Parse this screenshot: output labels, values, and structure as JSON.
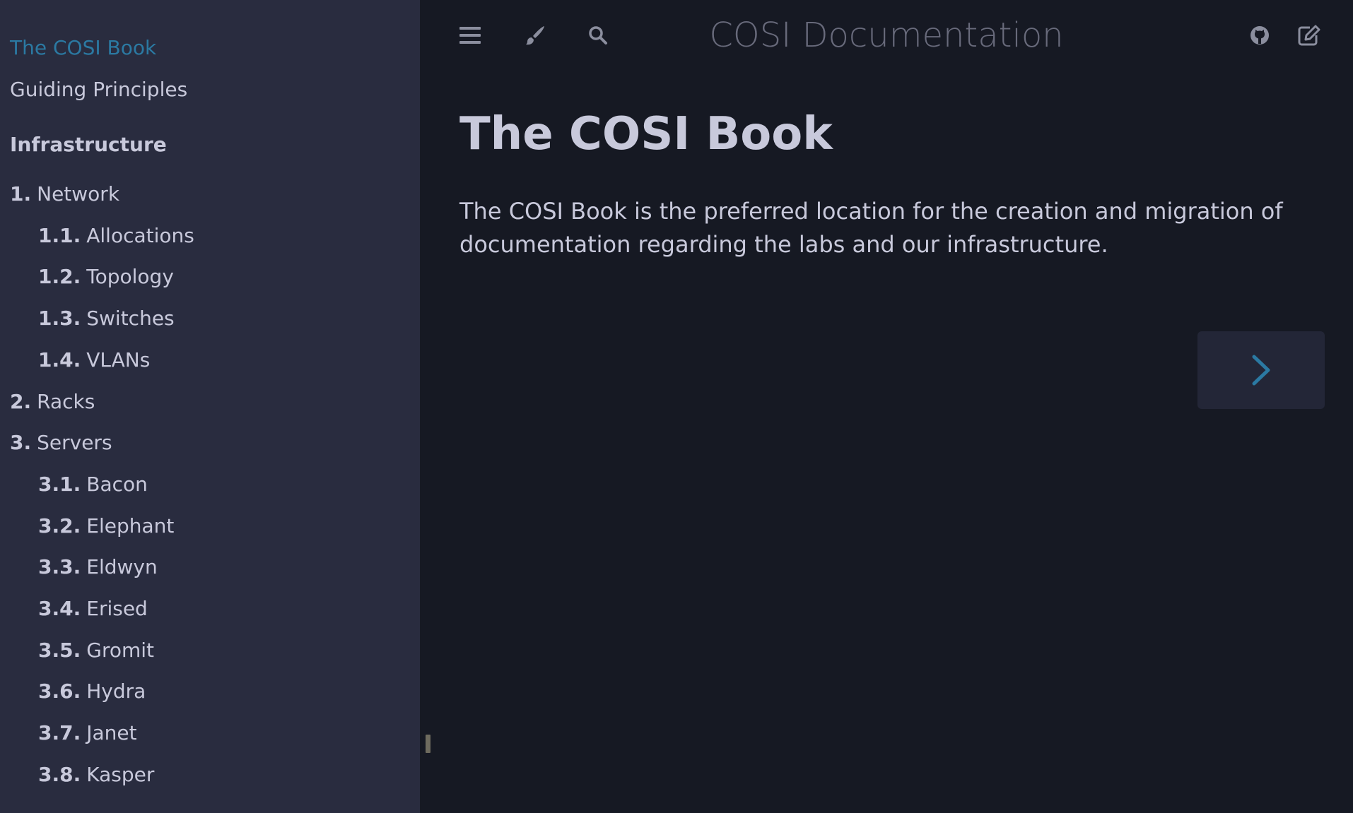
{
  "header": {
    "book_title": "COSI Documentation",
    "icons": [
      "hamburger-icon",
      "paintbrush-icon",
      "search-icon",
      "github-icon",
      "edit-icon"
    ]
  },
  "sidebar": {
    "items": [
      {
        "number": "",
        "label": "The COSI Book",
        "active": true
      },
      {
        "number": "",
        "label": "Guiding Principles"
      },
      {
        "number": "1.",
        "label": "Network"
      },
      {
        "number": "1.1.",
        "label": "Allocations"
      },
      {
        "number": "1.2.",
        "label": "Topology"
      },
      {
        "number": "1.3.",
        "label": "Switches"
      },
      {
        "number": "1.4.",
        "label": "VLANs"
      },
      {
        "number": "2.",
        "label": "Racks"
      },
      {
        "number": "3.",
        "label": "Servers"
      },
      {
        "number": "3.1.",
        "label": "Bacon"
      },
      {
        "number": "3.2.",
        "label": "Elephant"
      },
      {
        "number": "3.3.",
        "label": "Eldwyn"
      },
      {
        "number": "3.4.",
        "label": "Erised"
      },
      {
        "number": "3.5.",
        "label": "Gromit"
      },
      {
        "number": "3.6.",
        "label": "Hydra"
      },
      {
        "number": "3.7.",
        "label": "Janet"
      },
      {
        "number": "3.8.",
        "label": "Kasper"
      }
    ],
    "part_title": "Infrastructure"
  },
  "main": {
    "title": "The COSI Book",
    "intro": "The COSI Book is the preferred location for the creation and migration of documentation regarding the labs and our infrastructure."
  },
  "colors": {
    "sidebar_bg": "#292c3f",
    "content_bg": "#161923",
    "text": "#c8c9db",
    "accent": "#2b79a2",
    "icon": "#8b8e9e"
  }
}
